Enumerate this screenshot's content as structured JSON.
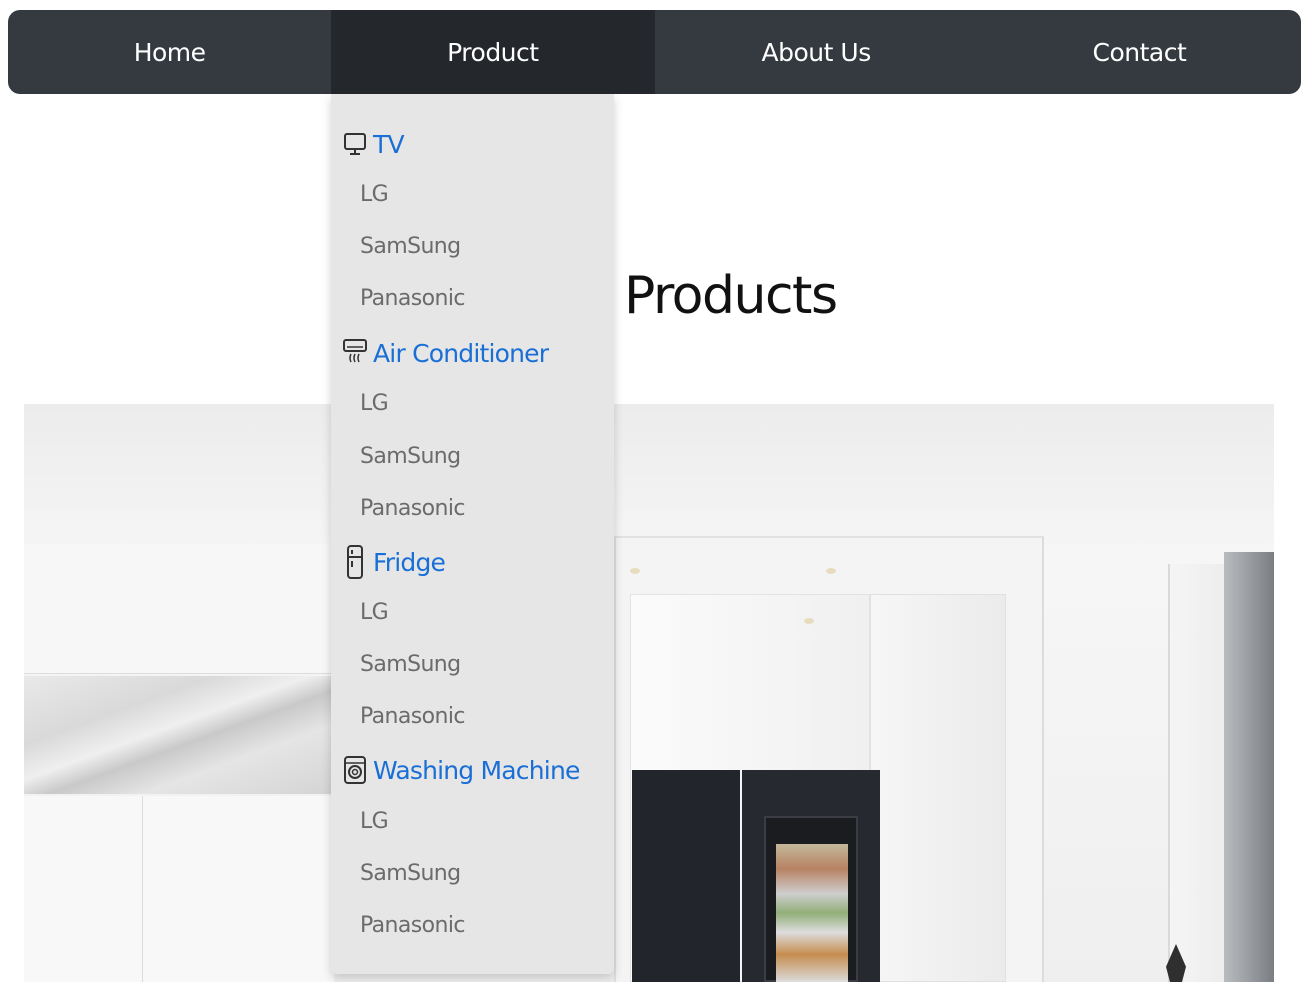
{
  "nav": {
    "items": [
      {
        "label": "Home"
      },
      {
        "label": "Product"
      },
      {
        "label": "About Us"
      },
      {
        "label": "Contact"
      }
    ],
    "active": "Product"
  },
  "page": {
    "title": "Products"
  },
  "dropdown": {
    "categories": [
      {
        "label": "TV",
        "icon": "tv-icon",
        "brands": [
          "LG",
          "SamSung",
          "Panasonic"
        ]
      },
      {
        "label": "Air Conditioner",
        "icon": "air-conditioner-icon",
        "brands": [
          "LG",
          "SamSung",
          "Panasonic"
        ]
      },
      {
        "label": "Fridge",
        "icon": "fridge-icon",
        "brands": [
          "LG",
          "SamSung",
          "Panasonic"
        ]
      },
      {
        "label": "Washing Machine",
        "icon": "washing-machine-icon",
        "brands": [
          "LG",
          "SamSung",
          "Panasonic"
        ]
      }
    ]
  },
  "hero": {
    "image": "kitchen-with-lg-fridge"
  },
  "colors": {
    "navbar": "#343a40",
    "navbar_active": "#24282c",
    "dropdown_bg": "#e6e6e6",
    "category_text": "#1a6fd6",
    "item_text": "#6b6b6b"
  }
}
